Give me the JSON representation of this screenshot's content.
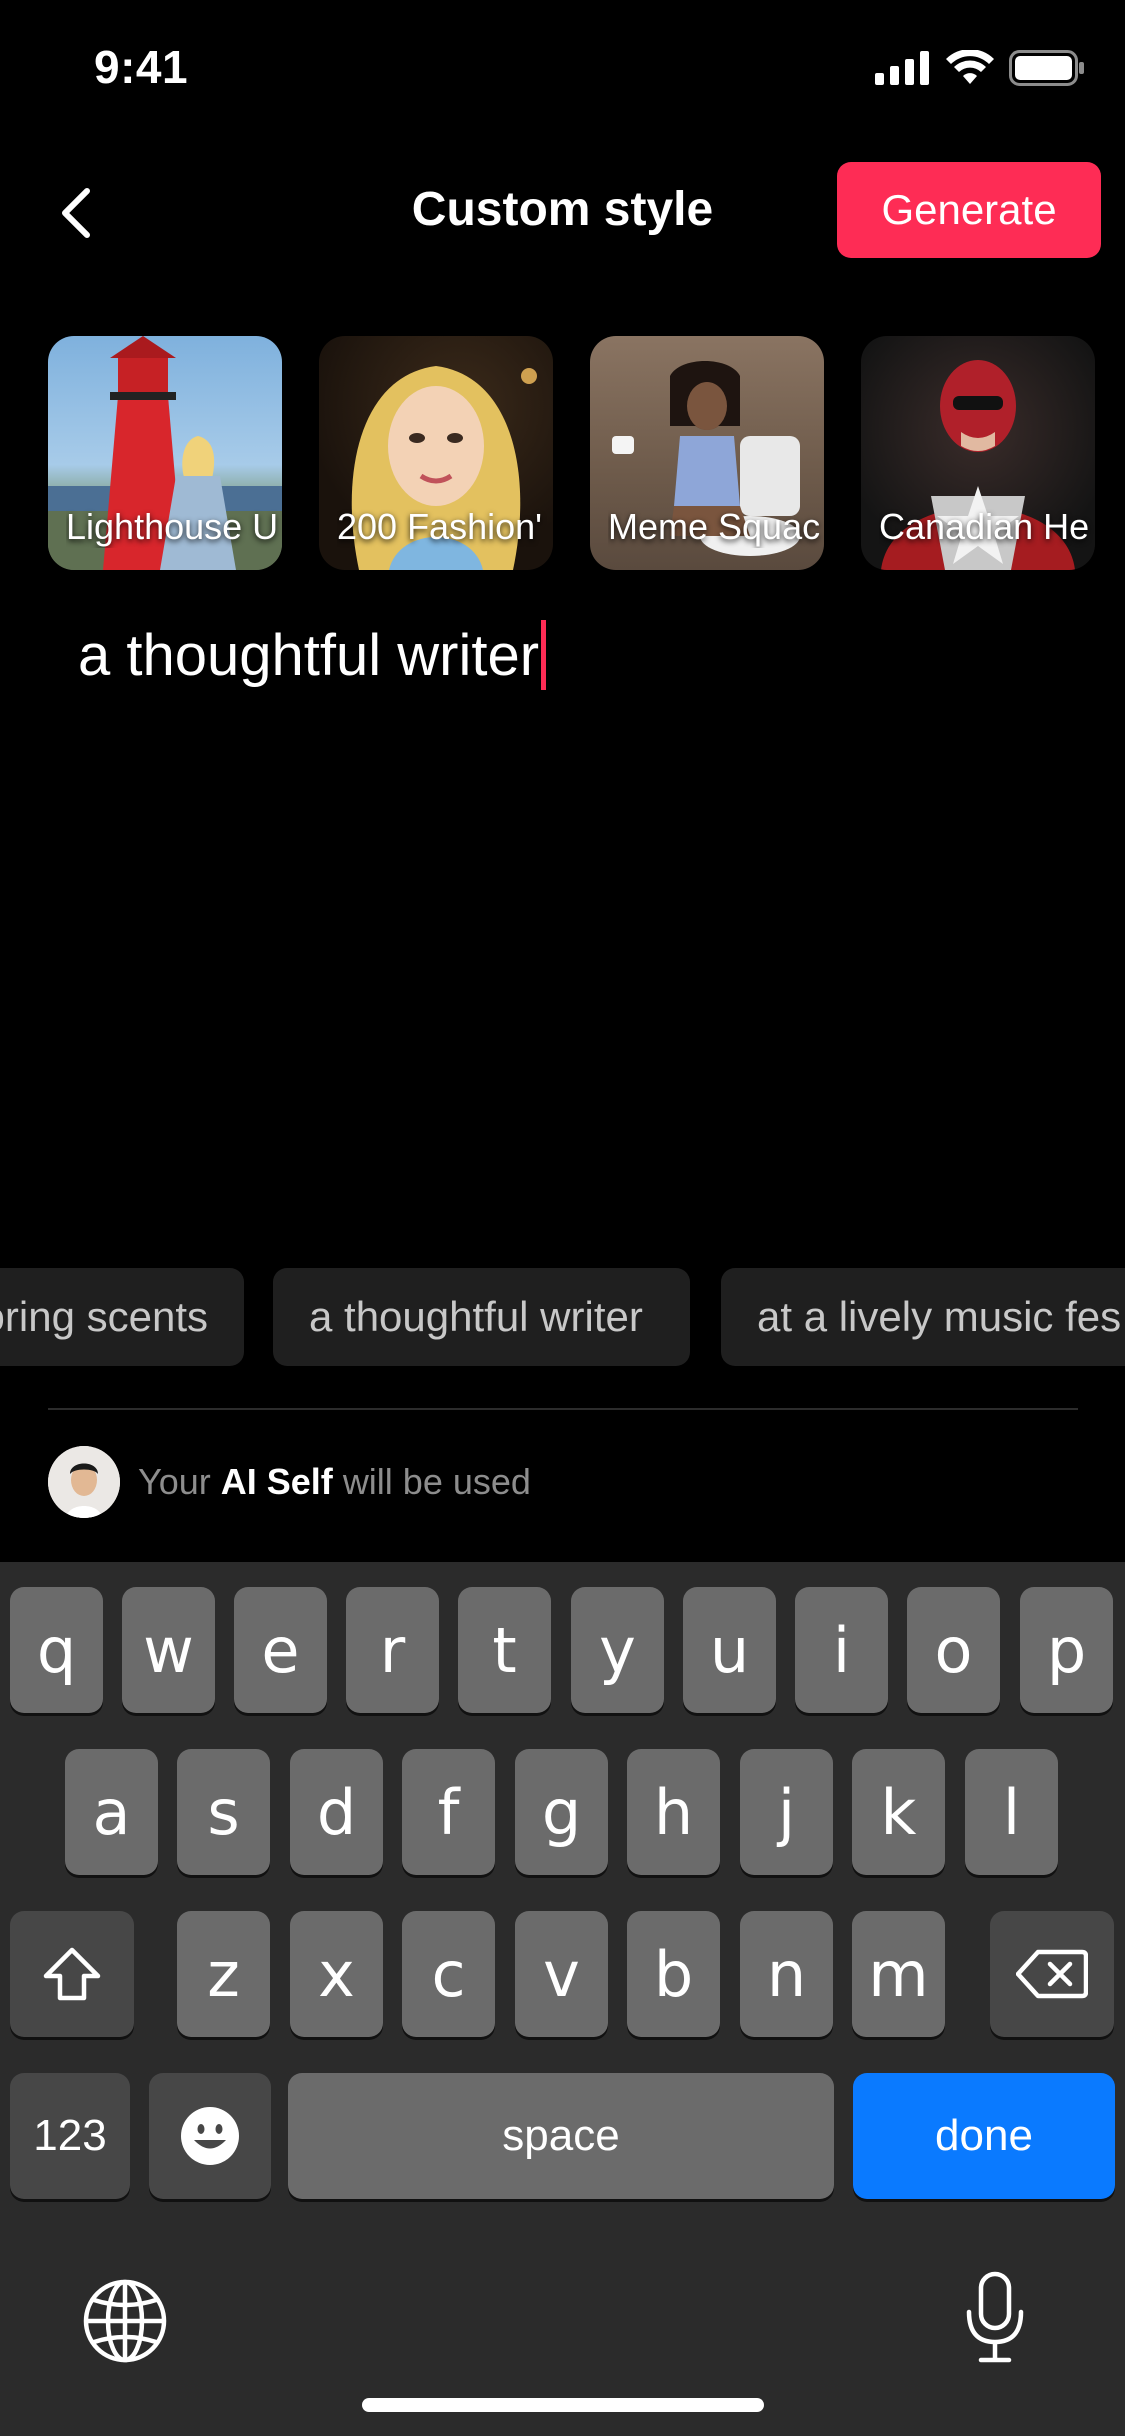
{
  "status_bar": {
    "time": "9:41"
  },
  "header": {
    "title": "Custom style",
    "generate_label": "Generate"
  },
  "style_cards": [
    {
      "label": "Lighthouse U"
    },
    {
      "label": "200 Fashion'"
    },
    {
      "label": "Meme Squac"
    },
    {
      "label": "Canadian He"
    }
  ],
  "prompt": {
    "text": "a thoughtful writer"
  },
  "suggestions": [
    {
      "label": "oring scents"
    },
    {
      "label": "a thoughtful writer"
    },
    {
      "label": "at a lively music fes"
    }
  ],
  "ai_self": {
    "prefix": "Your",
    "strong": "AI Self",
    "suffix": "will be used"
  },
  "keyboard": {
    "row1": [
      "q",
      "w",
      "e",
      "r",
      "t",
      "y",
      "u",
      "i",
      "o",
      "p"
    ],
    "row2": [
      "a",
      "s",
      "d",
      "f",
      "g",
      "h",
      "j",
      "k",
      "l"
    ],
    "row3": [
      "z",
      "x",
      "c",
      "v",
      "b",
      "n",
      "m"
    ],
    "numbers_label": "123",
    "space_label": "space",
    "done_label": "done"
  },
  "colors": {
    "accent": "#fe2c55",
    "done_blue": "#0a7aff"
  }
}
